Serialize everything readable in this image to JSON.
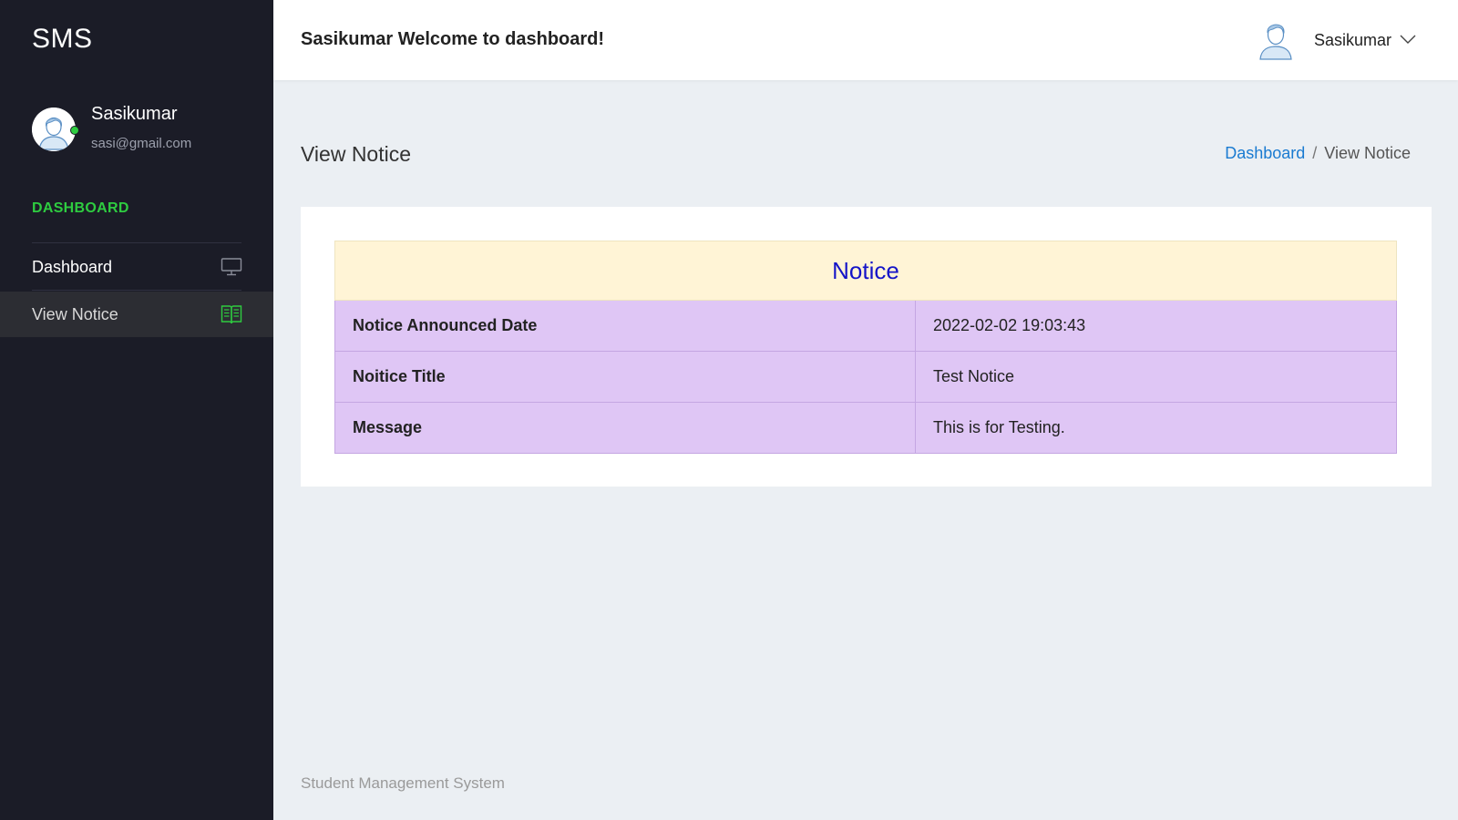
{
  "sidebar": {
    "brand": "SMS",
    "profile": {
      "name": "Sasikumar",
      "email": "sasi@gmail.com",
      "status_color": "#2ecc40"
    },
    "section_title": "DASHBOARD",
    "items": [
      {
        "label": "Dashboard",
        "icon": "monitor-icon",
        "active": false
      },
      {
        "label": "View Notice",
        "icon": "book-icon",
        "active": true
      }
    ]
  },
  "header": {
    "welcome": "Sasikumar Welcome to dashboard!",
    "user_name": "Sasikumar"
  },
  "page": {
    "title": "View Notice",
    "breadcrumb": {
      "home": "Dashboard",
      "separator": "/",
      "current": "View Notice"
    }
  },
  "notice": {
    "heading": "Notice",
    "rows": [
      {
        "key": "Notice Announced Date",
        "value": "2022-02-02 19:03:43"
      },
      {
        "key": "Noitice Title",
        "value": "Test Notice"
      },
      {
        "key": "Message",
        "value": "This is for Testing."
      }
    ]
  },
  "footer": {
    "text": "Student Management System"
  },
  "colors": {
    "accent_green": "#2ecc40",
    "link_blue": "#1a7bd1",
    "notice_heading": "#1414c8"
  }
}
